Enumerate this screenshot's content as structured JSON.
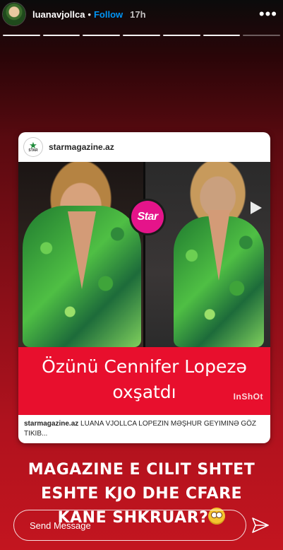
{
  "header": {
    "username": "luanavjollca",
    "dot": "•",
    "follow_label": "Follow",
    "time": "17h",
    "more_icon": "more-dots-icon"
  },
  "progress": {
    "total_segments": 7,
    "completed_segments": 6
  },
  "card": {
    "site_name": "starmagazine.az",
    "logo_text": "STAR",
    "badge_text": "Star",
    "headline_line1": "Özünü Cennifer Lopezə",
    "headline_line2": "oxşatdı",
    "watermark": "InShOt",
    "caption_site": "starmagazine.az",
    "caption_text": "LUANA VJOLLCA LOPEZIN MƏŞHUR GEYIMINƏ GÖZ TIKIB..."
  },
  "story_text": {
    "line1": "MAGAZINE E CILIT SHTET",
    "line2": "ESHTE KJO DHE CFARE",
    "line3": "KANE SHKRUAR?"
  },
  "reply": {
    "placeholder": "Send Message",
    "send_icon": "send-icon"
  },
  "colors": {
    "follow": "#0095f6",
    "headline_bg": "#e80f2d",
    "badge": "#e5148a",
    "background_bottom": "#c3151f"
  }
}
